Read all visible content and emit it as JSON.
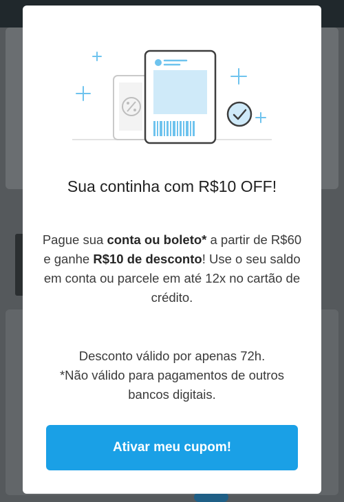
{
  "modal": {
    "title": "Sua continha com R$10 OFF!",
    "body": {
      "t1": "Pague sua ",
      "b1": "conta ou boleto*",
      "t2": " a partir de R$60 e ganhe ",
      "b2": "R$10 de desconto",
      "t3": "! Use o seu saldo em conta ou parcele em até 12x no cartão de crédito."
    },
    "notice_line1": "Desconto válido por apenas 72h.",
    "notice_line2": "*Não válido para pagamentos de outros bancos digitais.",
    "cta_label": "Ativar meu cupom!"
  },
  "illustration": {
    "icons": [
      "phone-icon",
      "percent-icon",
      "boleto-document-icon",
      "barcode-icon",
      "checkmark-badge-icon",
      "sparkle-plus-icon"
    ]
  },
  "colors": {
    "accent": "#1aa0e6",
    "illustration_blue": "#6ec3ee",
    "illustration_light": "#cfeaf9",
    "overlay": "#55595c"
  }
}
